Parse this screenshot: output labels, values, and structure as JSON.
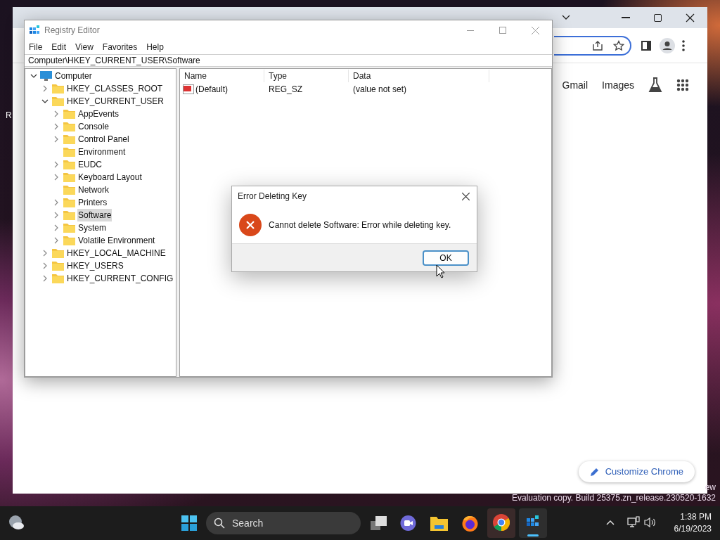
{
  "desktop": {
    "texts": [
      "R"
    ],
    "watermark_lines": [
      "ew",
      "Evaluation copy. Build 25375.zn_release.230520-1632"
    ]
  },
  "browser": {
    "links": [
      "Gmail",
      "Images"
    ],
    "customize_button": "Customize Chrome"
  },
  "registry_editor": {
    "title": "Registry Editor",
    "menu": [
      "File",
      "Edit",
      "View",
      "Favorites",
      "Help"
    ],
    "address": "Computer\\HKEY_CURRENT_USER\\Software",
    "tree": [
      {
        "label": "Computer",
        "kind": "computer",
        "expanded": true,
        "selected": false,
        "children": [
          {
            "label": "HKEY_CLASSES_ROOT",
            "kind": "branch",
            "expanded": false,
            "selected": false
          },
          {
            "label": "HKEY_CURRENT_USER",
            "kind": "branch",
            "expanded": true,
            "selected": false,
            "children": [
              {
                "label": "AppEvents",
                "kind": "branch",
                "expanded": false,
                "selected": false
              },
              {
                "label": "Console",
                "kind": "branch",
                "expanded": false,
                "selected": false
              },
              {
                "label": "Control Panel",
                "kind": "branch",
                "expanded": false,
                "selected": false
              },
              {
                "label": "Environment",
                "kind": "leaf",
                "selected": false
              },
              {
                "label": "EUDC",
                "kind": "branch",
                "expanded": false,
                "selected": false
              },
              {
                "label": "Keyboard Layout",
                "kind": "branch",
                "expanded": false,
                "selected": false
              },
              {
                "label": "Network",
                "kind": "leaf",
                "selected": false
              },
              {
                "label": "Printers",
                "kind": "branch",
                "expanded": false,
                "selected": false
              },
              {
                "label": "Software",
                "kind": "branch",
                "expanded": false,
                "selected": true
              },
              {
                "label": "System",
                "kind": "branch",
                "expanded": false,
                "selected": false
              },
              {
                "label": "Volatile Environment",
                "kind": "branch",
                "expanded": false,
                "selected": false
              }
            ]
          },
          {
            "label": "HKEY_LOCAL_MACHINE",
            "kind": "branch",
            "expanded": false,
            "selected": false
          },
          {
            "label": "HKEY_USERS",
            "kind": "branch",
            "expanded": false,
            "selected": false
          },
          {
            "label": "HKEY_CURRENT_CONFIG",
            "kind": "branch",
            "expanded": false,
            "selected": false
          }
        ]
      }
    ],
    "columns": [
      "Name",
      "Type",
      "Data"
    ],
    "rows": [
      [
        "(Default)",
        "REG_SZ",
        "(value not set)"
      ]
    ]
  },
  "dialog": {
    "title": "Error Deleting Key",
    "message": "Cannot delete Software:  Error while deleting key.",
    "button": "OK"
  },
  "taskbar": {
    "search_placeholder": "Search",
    "time": "1:38 PM",
    "date": "6/19/2023"
  }
}
